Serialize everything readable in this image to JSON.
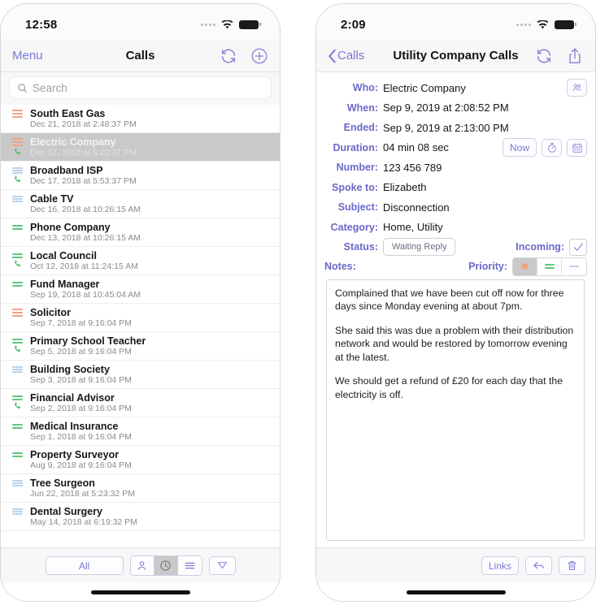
{
  "left_phone": {
    "statusbar": {
      "time": "12:58",
      "signal_icon": "signal-dots-icon",
      "wifi_icon": "wifi-icon",
      "battery_icon": "battery-full-icon"
    },
    "navbar": {
      "menu_label": "Menu",
      "title": "Calls",
      "refresh_icon": "refresh-icon",
      "add_icon": "plus-circle-icon"
    },
    "search": {
      "placeholder": "Search",
      "icon": "search-icon"
    },
    "list": [
      {
        "title": "South East Gas",
        "subtitle": "Dec 21, 2018 at 2:48:37 PM",
        "priority": "high",
        "has_call": false,
        "selected": false
      },
      {
        "title": "Electric Company",
        "subtitle": "Dec 17, 2018 at 6:22:37 PM",
        "priority": "high",
        "has_call": true,
        "selected": true
      },
      {
        "title": "Broadband ISP",
        "subtitle": "Dec 17, 2018 at 5:53:37 PM",
        "priority": "low",
        "has_call": true,
        "selected": false
      },
      {
        "title": "Cable TV",
        "subtitle": "Dec 16, 2018 at 10:26:15 AM",
        "priority": "low",
        "has_call": false,
        "selected": false
      },
      {
        "title": "Phone Company",
        "subtitle": "Dec 13, 2018 at 10:26:15 AM",
        "priority": "medium",
        "has_call": false,
        "selected": false
      },
      {
        "title": "Local Council",
        "subtitle": "Oct 12, 2018 at 11:24:15 AM",
        "priority": "medium",
        "has_call": true,
        "selected": false
      },
      {
        "title": "Fund Manager",
        "subtitle": "Sep 19, 2018 at 10:45:04 AM",
        "priority": "medium",
        "has_call": false,
        "selected": false
      },
      {
        "title": "Solicitor",
        "subtitle": "Sep 7, 2018 at 9:16:04 PM",
        "priority": "high",
        "has_call": false,
        "selected": false
      },
      {
        "title": "Primary School Teacher",
        "subtitle": "Sep 5, 2018 at 9:16:04 PM",
        "priority": "medium",
        "has_call": true,
        "selected": false
      },
      {
        "title": "Building Society",
        "subtitle": "Sep 3, 2018 at 9:16:04 PM",
        "priority": "low",
        "has_call": false,
        "selected": false
      },
      {
        "title": "Financial Advisor",
        "subtitle": "Sep 2, 2018 at 9:16:04 PM",
        "priority": "medium",
        "has_call": true,
        "selected": false
      },
      {
        "title": "Medical Insurance",
        "subtitle": "Sep 1, 2018 at 9:16:04 PM",
        "priority": "medium",
        "has_call": false,
        "selected": false
      },
      {
        "title": "Property Surveyor",
        "subtitle": "Aug 9, 2018 at 9:16:04 PM",
        "priority": "medium",
        "has_call": false,
        "selected": false
      },
      {
        "title": "Tree Surgeon",
        "subtitle": "Jun 22, 2018 at 5:23:32 PM",
        "priority": "low",
        "has_call": false,
        "selected": false
      },
      {
        "title": "Dental Surgery",
        "subtitle": "May 14, 2018 at 6:19:32 PM",
        "priority": "low",
        "has_call": false,
        "selected": false
      }
    ],
    "toolbar": {
      "filter_label": "All",
      "contact_icon": "contact-icon",
      "clock_icon": "clock-icon",
      "list_icon": "list-lines-icon",
      "funnel_icon": "funnel-icon",
      "selected_segment": "clock-icon"
    }
  },
  "right_phone": {
    "statusbar": {
      "time": "2:09",
      "signal_icon": "signal-dots-icon",
      "wifi_icon": "wifi-icon",
      "battery_icon": "battery-full-icon"
    },
    "navbar": {
      "back_label": "Calls",
      "back_icon": "chevron-left-icon",
      "title": "Utility Company Calls",
      "refresh_icon": "refresh-icon",
      "share_icon": "share-icon"
    },
    "fields": {
      "who_label": "Who:",
      "who_value": "Electric Company",
      "when_label": "When:",
      "when_value": "Sep 9, 2019 at 2:08:52 PM",
      "ended_label": "Ended:",
      "ended_value": "Sep 9, 2019 at 2:13:00 PM",
      "duration_label": "Duration:",
      "duration_value": "04 min 08 sec",
      "number_label": "Number:",
      "number_value": "123 456 789",
      "spoke_to_label": "Spoke to:",
      "spoke_to_value": "Elizabeth",
      "subject_label": "Subject:",
      "subject_value": "Disconnection",
      "category_label": "Category:",
      "category_value": "Home, Utility",
      "status_label": "Status:",
      "status_value": "Waiting Reply",
      "incoming_label": "Incoming:",
      "incoming_checked": true,
      "priority_label": "Priority:",
      "priority_selected": "high",
      "notes_label": "Notes:"
    },
    "buttons": {
      "contact_icon": "contacts-group-icon",
      "now_label": "Now",
      "stopwatch_icon": "stopwatch-icon",
      "calendar_icon": "calendar-icon",
      "check_icon": "checkmark-icon"
    },
    "notes": [
      "Complained that we have been cut off now for three days since Monday evening at about 7pm.",
      "She said this was due a problem with their distribution network and would be restored by tomorrow evening at the latest.",
      "We should get a refund of £20 for each day that the electricity is off."
    ],
    "toolbar": {
      "links_label": "Links",
      "reply_icon": "reply-arrow-icon",
      "trash_icon": "trash-icon"
    }
  },
  "colors": {
    "tint": "#7b79d6",
    "label": "#6b69c9",
    "priority_high": "#f0a282",
    "priority_medium": "#5ec77e",
    "priority_low": "#b9d2ea",
    "call_green": "#4cbf6a",
    "selected_row": "#c9c9c9"
  }
}
